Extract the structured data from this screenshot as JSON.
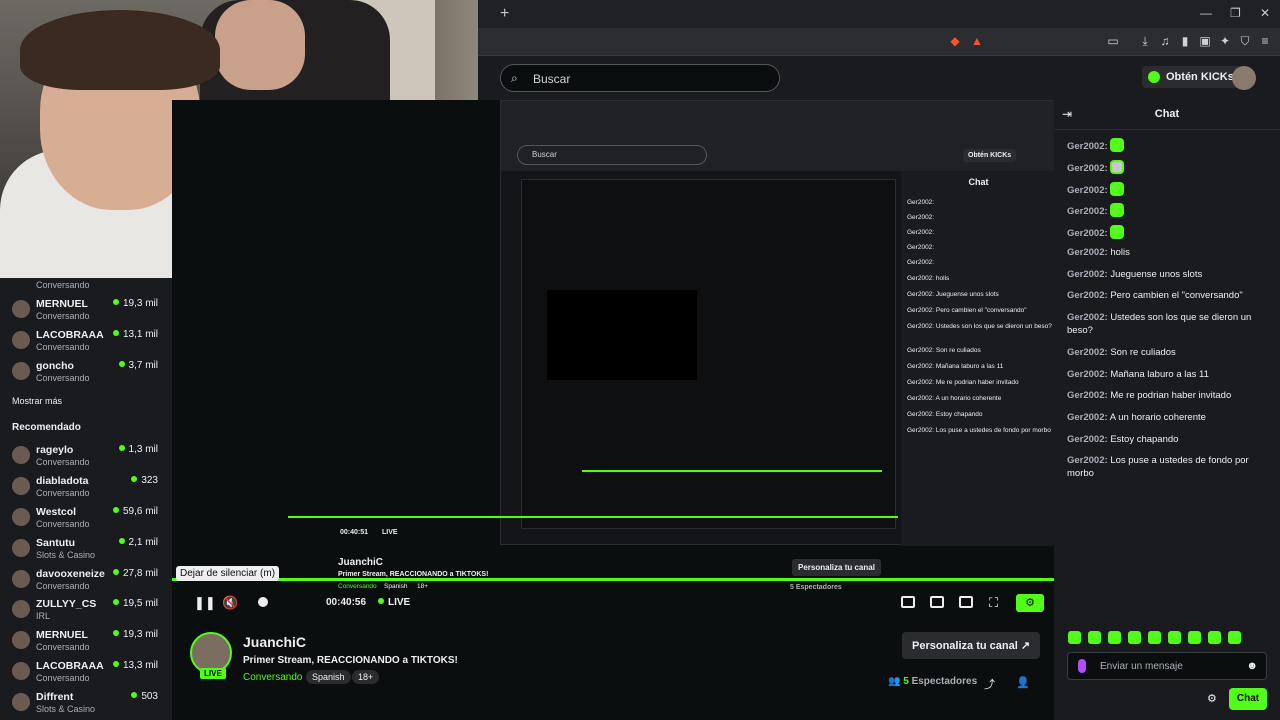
{
  "sidebar": {
    "top_partial_category": "Conversando",
    "following": [
      {
        "name": "MERNUEL",
        "category": "Conversando",
        "viewers": "19,3 mil"
      },
      {
        "name": "LACOBRAAA",
        "category": "Conversando",
        "viewers": "13,1 mil"
      },
      {
        "name": "goncho",
        "category": "Conversando",
        "viewers": "3,7 mil"
      }
    ],
    "show_more": "Mostrar más",
    "recommended_title": "Recomendado",
    "recommended": [
      {
        "name": "rageylo",
        "category": "Conversando",
        "viewers": "1,3 mil"
      },
      {
        "name": "diabladota",
        "category": "Conversando",
        "viewers": "323"
      },
      {
        "name": "Westcol",
        "category": "Conversando",
        "viewers": "59,6 mil"
      },
      {
        "name": "Santutu",
        "category": "Slots & Casino",
        "viewers": "2,1 mil"
      },
      {
        "name": "davooxeneize",
        "category": "Conversando",
        "viewers": "27,8 mil"
      },
      {
        "name": "ZULLYY_CS",
        "category": "IRL",
        "viewers": "19,5 mil"
      },
      {
        "name": "MERNUEL",
        "category": "Conversando",
        "viewers": "19,3 mil"
      },
      {
        "name": "LACOBRAAA",
        "category": "Conversando",
        "viewers": "13,3 mil"
      },
      {
        "name": "Diffrent",
        "category": "Slots & Casino",
        "viewers": "503"
      }
    ]
  },
  "topnav": {
    "search_placeholder": "Buscar",
    "kicks_button": "Obtén KICKs"
  },
  "recursive": {
    "search": "Buscar",
    "kicks": "Obtén KICKs",
    "chat_title": "Chat",
    "lines": [
      "Ger2002:",
      "Ger2002:",
      "Ger2002:",
      "Ger2002:",
      "Ger2002:",
      "Ger2002: holis",
      "Ger2002: Jueguense unos slots",
      "Ger2002: Pero cambien el \"conversando\"",
      "Ger2002: Ustedes son los que se dieron un beso?",
      "Ger2002: Son re culiados",
      "Ger2002: Mañana laburo a las 11",
      "Ger2002: Me re podrian haber invitado",
      "Ger2002: A un horario coherente",
      "Ger2002: Estoy chapando",
      "Ger2002: Los puse a ustedes de fondo por morbo"
    ],
    "sub_channel": "JuanchiC",
    "sub_title": "Primer Stream, REACCIONANDO a TIKTOKS!",
    "sub_category": "Conversando",
    "sub_lang": "Spanish",
    "sub_age": "18+",
    "sub_personaliza": "Personaliza tu canal",
    "sub_viewers": "5 Espectadores",
    "sub_time": "00:40:51",
    "sub_live": "LIVE"
  },
  "player": {
    "tooltip": "Dejar de silenciar (m)",
    "time": "00:40:56",
    "live": "LIVE",
    "progress_fraction": 1.0
  },
  "stream": {
    "channel": "JuanchiC",
    "live_badge": "LIVE",
    "title": "Primer Stream, REACCIONANDO a TIKTOKS!",
    "category": "Conversando",
    "tags": [
      "Spanish",
      "18+"
    ],
    "personaliza": "Personaliza tu canal",
    "viewer_count": "5",
    "viewer_label": "Espectadores"
  },
  "chat": {
    "title": "Chat",
    "messages": [
      {
        "user": "Ger2002:",
        "text": "",
        "emote": "green"
      },
      {
        "user": "Ger2002:",
        "text": "",
        "emote": "alt"
      },
      {
        "user": "Ger2002:",
        "text": "",
        "emote": "green"
      },
      {
        "user": "Ger2002:",
        "text": "",
        "emote": "green"
      },
      {
        "user": "Ger2002:",
        "text": "",
        "emote": "green"
      },
      {
        "user": "Ger2002:",
        "text": "holis"
      },
      {
        "user": "Ger2002:",
        "text": "Jueguense unos slots"
      },
      {
        "user": "Ger2002:",
        "text": "Pero cambien el \"conversando\""
      },
      {
        "user": "Ger2002:",
        "text": "Ustedes son los que se dieron un beso?"
      },
      {
        "user": "Ger2002:",
        "text": "Son re culiados"
      },
      {
        "user": "Ger2002:",
        "text": "Mañana laburo a las 11"
      },
      {
        "user": "Ger2002:",
        "text": "Me re podrian haber invitado"
      },
      {
        "user": "Ger2002:",
        "text": "A un horario coherente"
      },
      {
        "user": "Ger2002:",
        "text": "Estoy chapando"
      },
      {
        "user": "Ger2002:",
        "text": "Los puse a ustedes de fondo por morbo"
      }
    ],
    "input_placeholder": "Enviar un mensaje",
    "send_label": "Chat"
  },
  "colors": {
    "accent": "#53fc18",
    "background": "#0b0e0f",
    "panel": "#191b1f"
  }
}
